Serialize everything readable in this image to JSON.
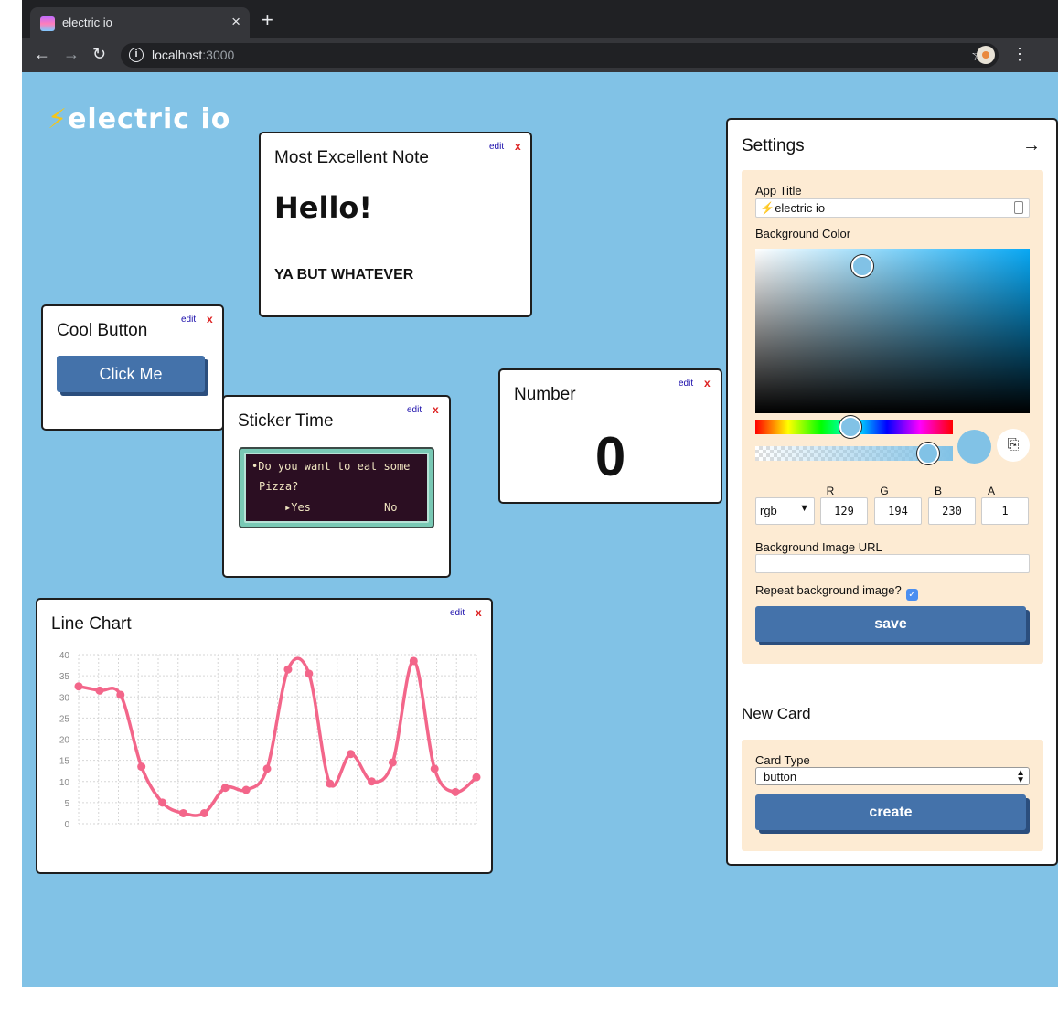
{
  "browser": {
    "tab_title": "electric io",
    "tab_close": "×",
    "new_tab": "+",
    "back": "←",
    "forward": "→",
    "reload": "↻",
    "info": "i",
    "url_host": "localhost",
    "url_port": ":3000",
    "bookmark_star": "☆",
    "menu": "⋮"
  },
  "app": {
    "bolt": "⚡",
    "title": "electric io",
    "background_color": "#81c2e6"
  },
  "cards": {
    "note": {
      "title": "Most Excellent Note",
      "edit": "edit",
      "close": "x",
      "heading": "Hello!",
      "body": "YA BUT WHATEVER"
    },
    "button": {
      "title": "Cool Button",
      "edit": "edit",
      "close": "x",
      "label": "Click Me"
    },
    "sticker": {
      "title": "Sticker Time",
      "edit": "edit",
      "close": "x",
      "question_line1": "•Do you want to eat some",
      "question_line2": "Pizza?",
      "yes": "▸Yes",
      "no": "No"
    },
    "number": {
      "title": "Number",
      "edit": "edit",
      "close": "x",
      "value": "0"
    },
    "line_chart": {
      "title": "Line Chart",
      "edit": "edit",
      "close": "x"
    }
  },
  "chart_data": {
    "type": "line",
    "title": "Line Chart",
    "xlabel": "",
    "ylabel": "",
    "ylim": [
      0,
      40
    ],
    "yticks": [
      0,
      5,
      10,
      15,
      20,
      25,
      30,
      35,
      40
    ],
    "grid": true,
    "line_color": "#f3668a",
    "series": [
      {
        "values": [
          32.5,
          31.5,
          30.5,
          13.5,
          5,
          2.5,
          2.5,
          8.5,
          8,
          13,
          36.5,
          35.5,
          9.5,
          16.5,
          10,
          14.5,
          38.5,
          13,
          7.5,
          11
        ]
      }
    ]
  },
  "settings": {
    "title": "Settings",
    "collapse_arrow": "→",
    "app_title_label": "App Title",
    "app_title_bolt": "⚡",
    "app_title_value": "electric io",
    "background_color_label": "Background Color",
    "color_mode": "rgb",
    "color_mode_caret": "▼",
    "copy_icon": "⎘",
    "r_label": "R",
    "g_label": "G",
    "b_label": "B",
    "a_label": "A",
    "r": "129",
    "g": "194",
    "b": "230",
    "a": "1",
    "bg_image_label": "Background Image URL",
    "bg_image_value": "",
    "repeat_label": "Repeat background image?",
    "repeat_checked": "✓",
    "save_label": "save"
  },
  "new_card": {
    "title": "New Card",
    "card_type_label": "Card Type",
    "card_type_value": "button",
    "card_type_caret": "▲\n▼",
    "create_label": "create"
  },
  "colors": {
    "button_blue": "#4472aa",
    "panel_bg": "#fdebd3",
    "edit_link": "#1a0dab",
    "close_red": "#dd2222"
  }
}
